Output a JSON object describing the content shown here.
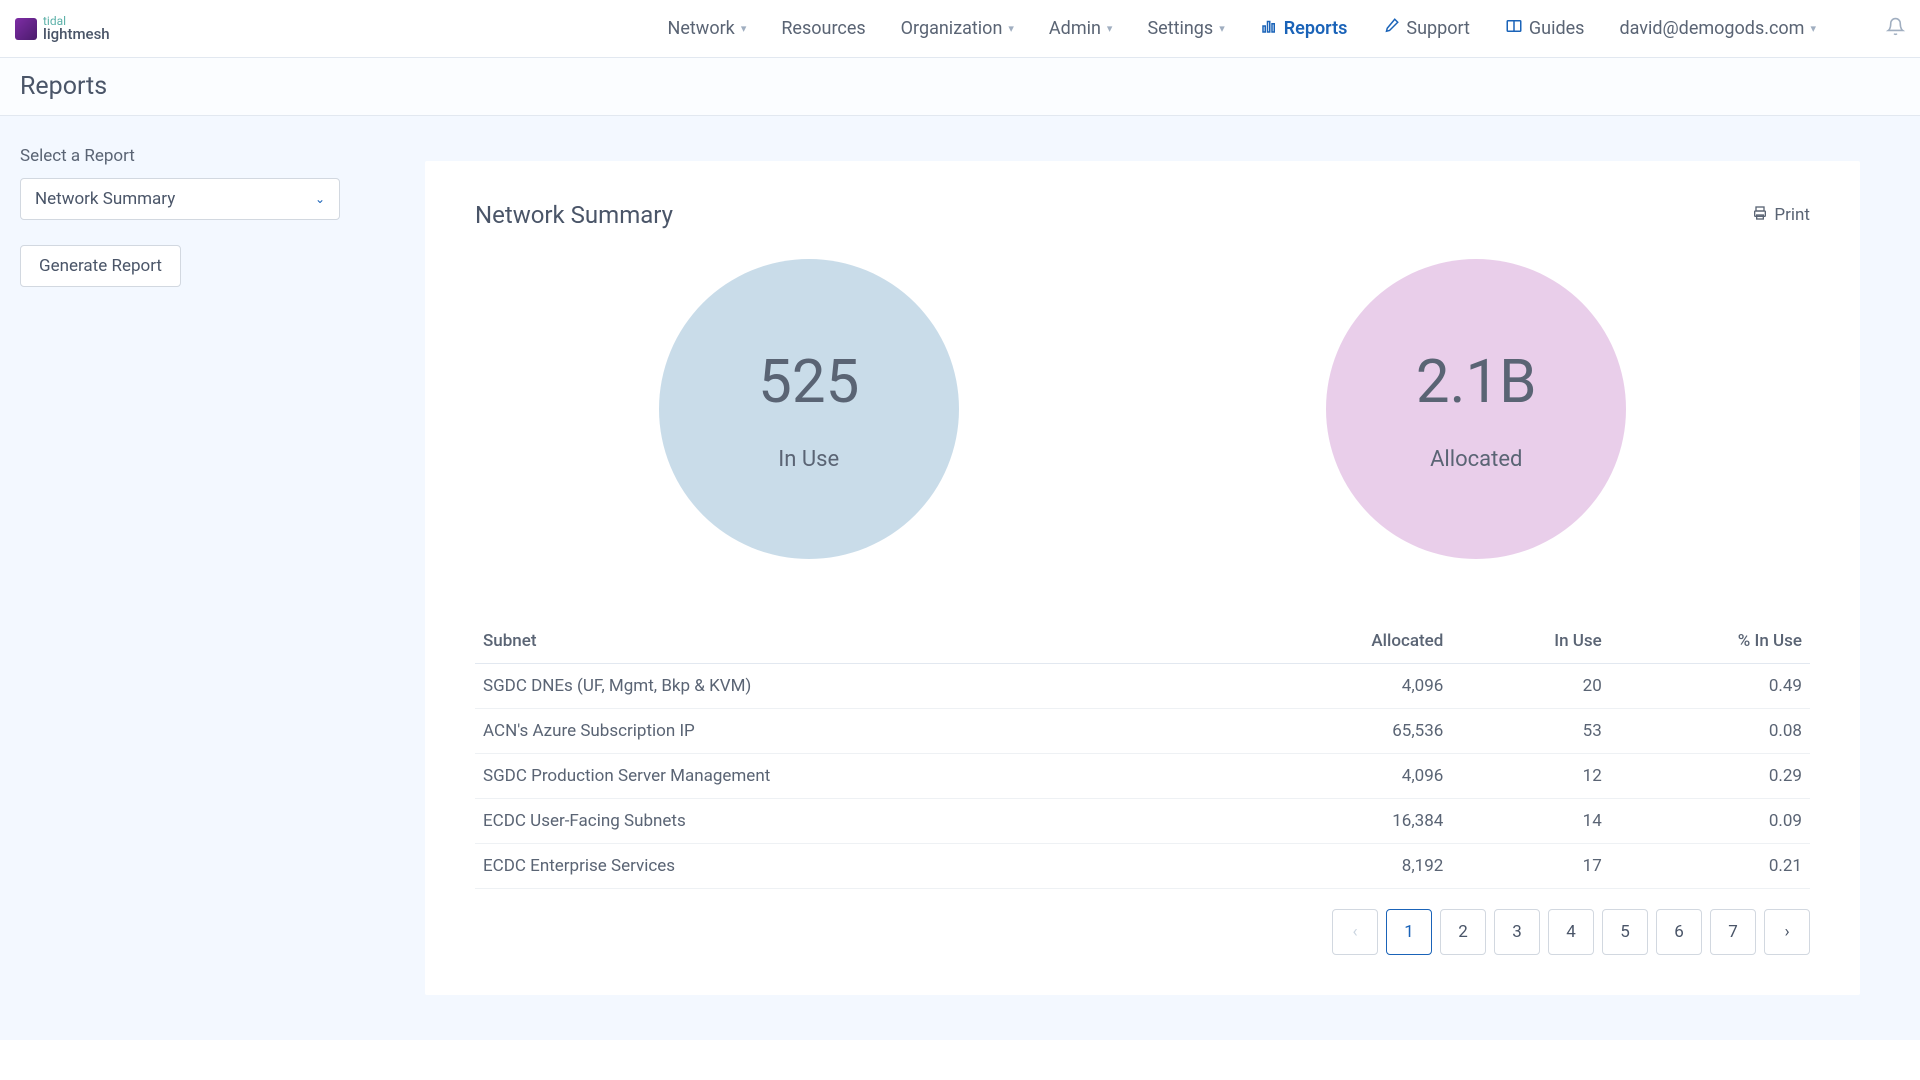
{
  "brand": {
    "top": "tidal",
    "bottom": "lightmesh"
  },
  "nav": {
    "network": "Network",
    "resources": "Resources",
    "organization": "Organization",
    "admin": "Admin",
    "settings": "Settings",
    "reports": "Reports",
    "support": "Support",
    "guides": "Guides",
    "user": "david@demogods.com"
  },
  "page_title": "Reports",
  "sidebar": {
    "select_label": "Select a Report",
    "select_value": "Network Summary",
    "generate_label": "Generate Report"
  },
  "report": {
    "title": "Network Summary",
    "print_label": "Print"
  },
  "chart_data": {
    "type": "table",
    "summary_circles": [
      {
        "value": "525",
        "label": "In Use",
        "color": "blue"
      },
      {
        "value": "2.1B",
        "label": "Allocated",
        "color": "pink"
      }
    ],
    "columns": [
      "Subnet",
      "Allocated",
      "In Use",
      "% In Use"
    ],
    "rows": [
      {
        "subnet": "SGDC DNEs (UF, Mgmt, Bkp & KVM)",
        "allocated": "4,096",
        "in_use": "20",
        "pct": "0.49"
      },
      {
        "subnet": "ACN's Azure Subscription IP",
        "allocated": "65,536",
        "in_use": "53",
        "pct": "0.08"
      },
      {
        "subnet": "SGDC Production Server Management",
        "allocated": "4,096",
        "in_use": "12",
        "pct": "0.29"
      },
      {
        "subnet": "ECDC User-Facing Subnets",
        "allocated": "16,384",
        "in_use": "14",
        "pct": "0.09"
      },
      {
        "subnet": "ECDC Enterprise Services",
        "allocated": "8,192",
        "in_use": "17",
        "pct": "0.21"
      }
    ]
  },
  "pagination": {
    "pages": [
      "1",
      "2",
      "3",
      "4",
      "5",
      "6",
      "7"
    ],
    "active": "1"
  }
}
